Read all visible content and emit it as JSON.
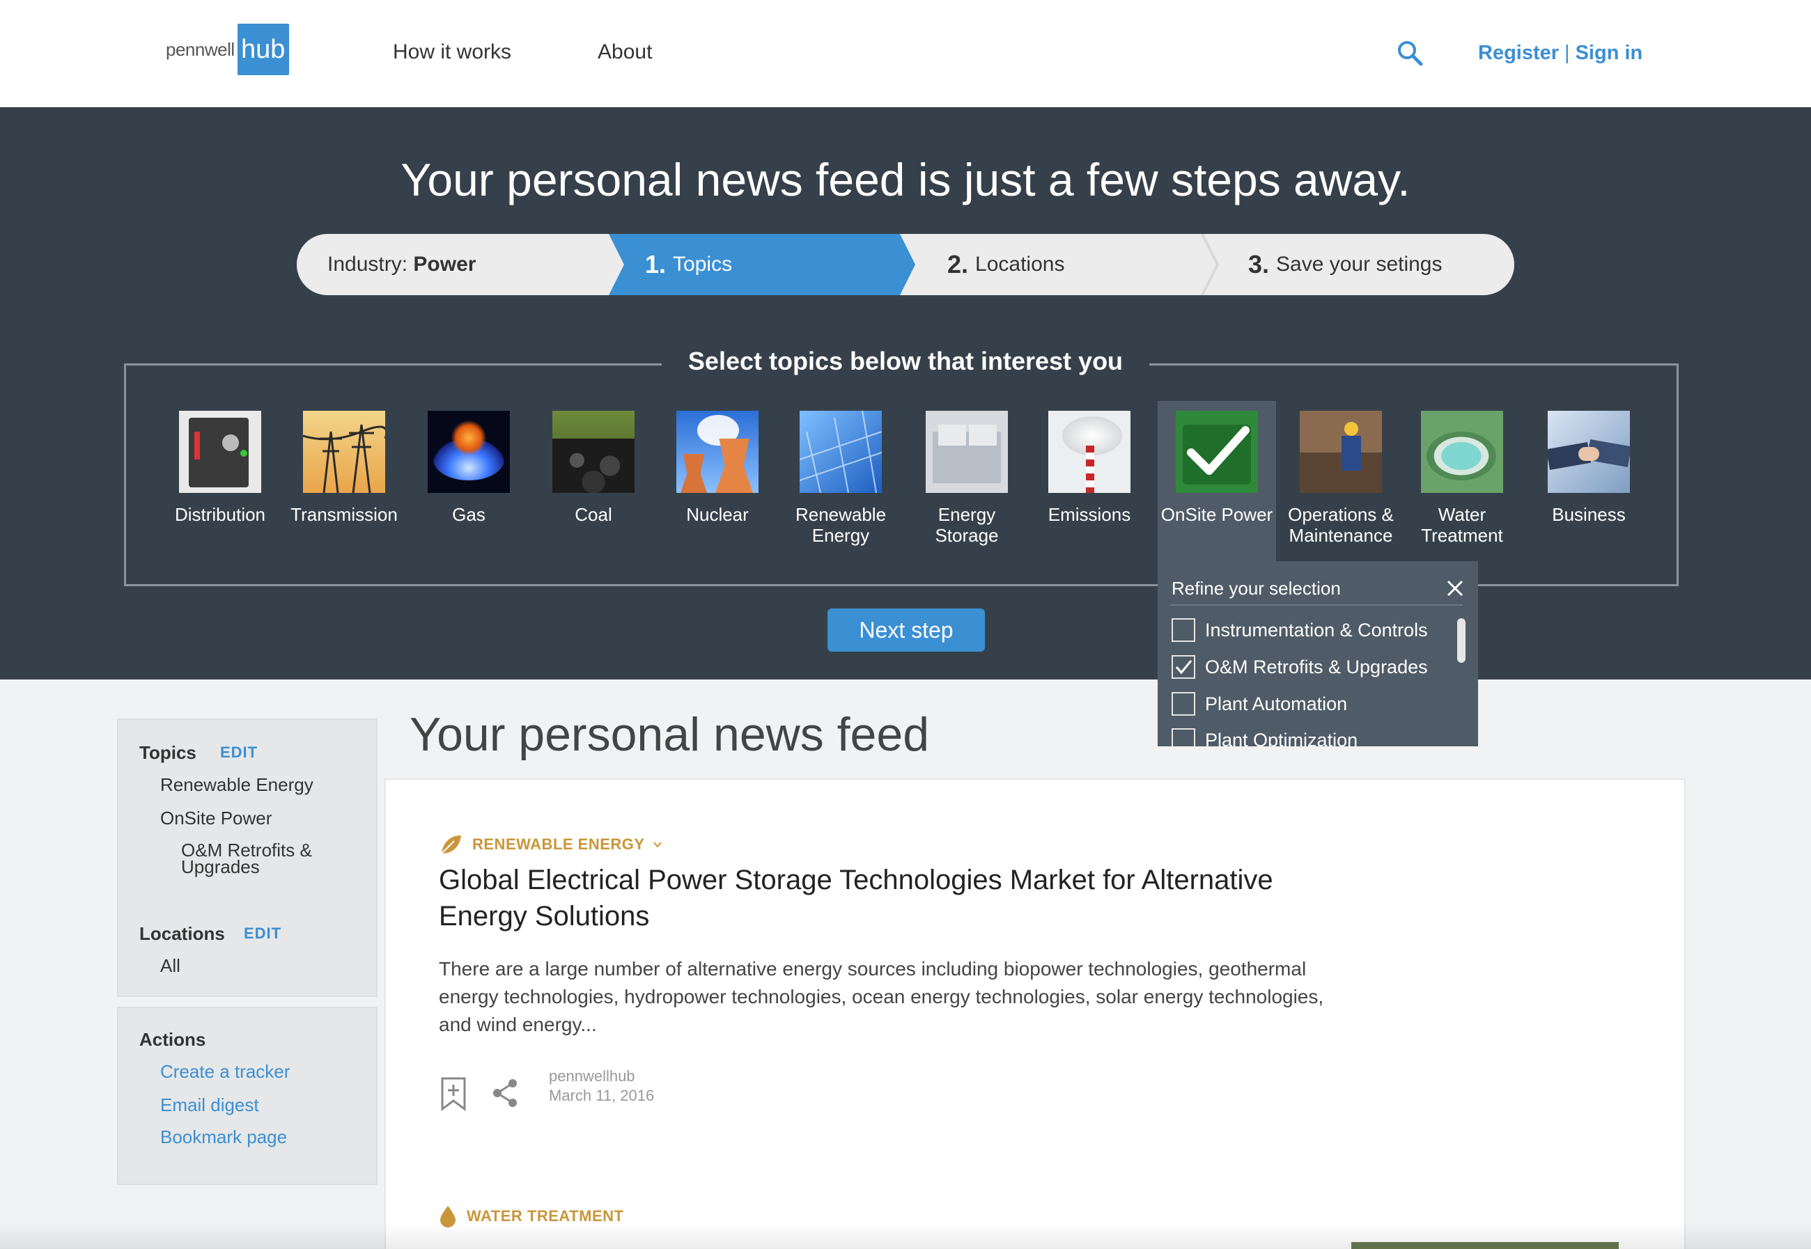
{
  "header": {
    "logo_text": "pennwell",
    "logo_box": "hub",
    "nav": [
      "How it works",
      "About"
    ],
    "register": "Register",
    "separator": "|",
    "signin": "Sign in"
  },
  "hero": {
    "title": "Your personal news feed is just a few steps away.",
    "steps": {
      "industry_prefix": "Industry: ",
      "industry_value": "Power",
      "step1_num": "1.",
      "step1_label": "Topics",
      "step2_num": "2.",
      "step2_label": "Locations",
      "step3_num": "3.",
      "step3_label": "Save your setings"
    },
    "topics_heading": "Select topics below that interest you",
    "topics": [
      {
        "label": "Distribution",
        "selected": false
      },
      {
        "label": "Transmission",
        "selected": false
      },
      {
        "label": "Gas",
        "selected": false
      },
      {
        "label": "Coal",
        "selected": false
      },
      {
        "label": "Nuclear",
        "selected": false
      },
      {
        "label": "Renewable Energy",
        "selected": false
      },
      {
        "label": "Energy Storage",
        "selected": false
      },
      {
        "label": "Emissions",
        "selected": false
      },
      {
        "label": "OnSite Power",
        "selected": true
      },
      {
        "label": "Operations & Maintenance",
        "selected": false
      },
      {
        "label": "Water Treatment",
        "selected": false
      },
      {
        "label": "Business",
        "selected": false
      }
    ],
    "next_step": "Next step"
  },
  "refine": {
    "title": "Refine your selection",
    "items": [
      {
        "label": "Instrumentation & Controls",
        "checked": false
      },
      {
        "label": "O&M Retrofits & Upgrades",
        "checked": true
      },
      {
        "label": "Plant Automation",
        "checked": false
      },
      {
        "label": "Plant Optimization",
        "checked": false
      }
    ]
  },
  "sidebar": {
    "topics_head": "Topics",
    "edit": "EDIT",
    "topics": [
      "Renewable Energy",
      "OnSite Power"
    ],
    "subtopic_line1": "O&M Retrofits &",
    "subtopic_line2": "Upgrades",
    "locations_head": "Locations",
    "locations": [
      "All"
    ],
    "actions_head": "Actions",
    "actions": [
      "Create a tracker",
      "Email digest",
      "Bookmark page"
    ]
  },
  "feed": {
    "title": "Your personal news feed",
    "articles": [
      {
        "category": "RENEWABLE ENERGY",
        "title": "Global Electrical Power Storage Technologies Market for Alternative Energy Solutions",
        "body": "There are a large number of alternative energy sources including biopower technologies, geothermal energy technologies, hydropower technologies, ocean energy technologies, solar energy technologies, and wind energy...",
        "source": "pennwellhub",
        "date": "March 11, 2016"
      },
      {
        "category": "WATER TREATMENT"
      }
    ]
  },
  "colors": {
    "accent": "#3b8fd3",
    "hero_bg": "#36404a",
    "category": "#c9963a"
  }
}
